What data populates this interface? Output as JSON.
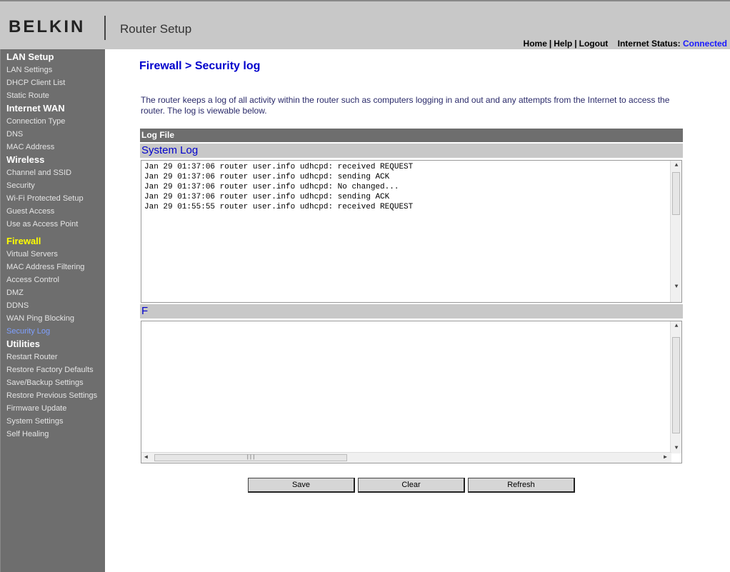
{
  "header": {
    "brand": "BELKIN",
    "app_title": "Router Setup",
    "nav": {
      "home": "Home",
      "help": "Help",
      "logout": "Logout",
      "sep": "|"
    },
    "status_label": "Internet Status:",
    "status_value": "Connected"
  },
  "sidebar": {
    "lan_setup": {
      "title": "LAN Setup",
      "items": [
        "LAN Settings",
        "DHCP Client List",
        "Static Route"
      ]
    },
    "internet_wan": {
      "title": "Internet WAN",
      "items": [
        "Connection Type",
        "DNS",
        "MAC Address"
      ]
    },
    "wireless": {
      "title": "Wireless",
      "items": [
        "Channel and SSID",
        "Security",
        "Wi-Fi Protected Setup",
        "Guest Access",
        "Use as Access Point"
      ]
    },
    "firewall": {
      "title": "Firewall",
      "items": [
        "Virtual Servers",
        "MAC Address Filtering",
        "Access Control",
        "DMZ",
        "DDNS",
        "WAN Ping Blocking",
        "Security Log"
      ]
    },
    "utilities": {
      "title": "Utilities",
      "items": [
        "Restart Router",
        "Restore Factory Defaults",
        "Save/Backup Settings",
        "Restore Previous Settings",
        "Firmware Update",
        "System Settings",
        "Self Healing"
      ]
    }
  },
  "main": {
    "page_title": "Firewall > Security log",
    "description": "The router keeps a log of all activity within the router such as computers logging in and out and any attempts from the Internet to access the router. The log is viewable below.",
    "logfile_label": "Log File",
    "system_log_title": "System Log",
    "system_log_lines": [
      "Jan 29 01:37:06 router user.info udhcpd: received REQUEST",
      "Jan 29 01:37:06 router user.info udhcpd: sending ACK",
      "Jan 29 01:37:06 router user.info udhcpd: No changed...",
      "Jan 29 01:37:06 router user.info udhcpd: sending ACK",
      "Jan 29 01:55:55 router user.info udhcpd: received REQUEST"
    ],
    "second_log_title": "F",
    "buttons": {
      "save": "Save",
      "clear": "Clear",
      "refresh": "Refresh"
    }
  }
}
